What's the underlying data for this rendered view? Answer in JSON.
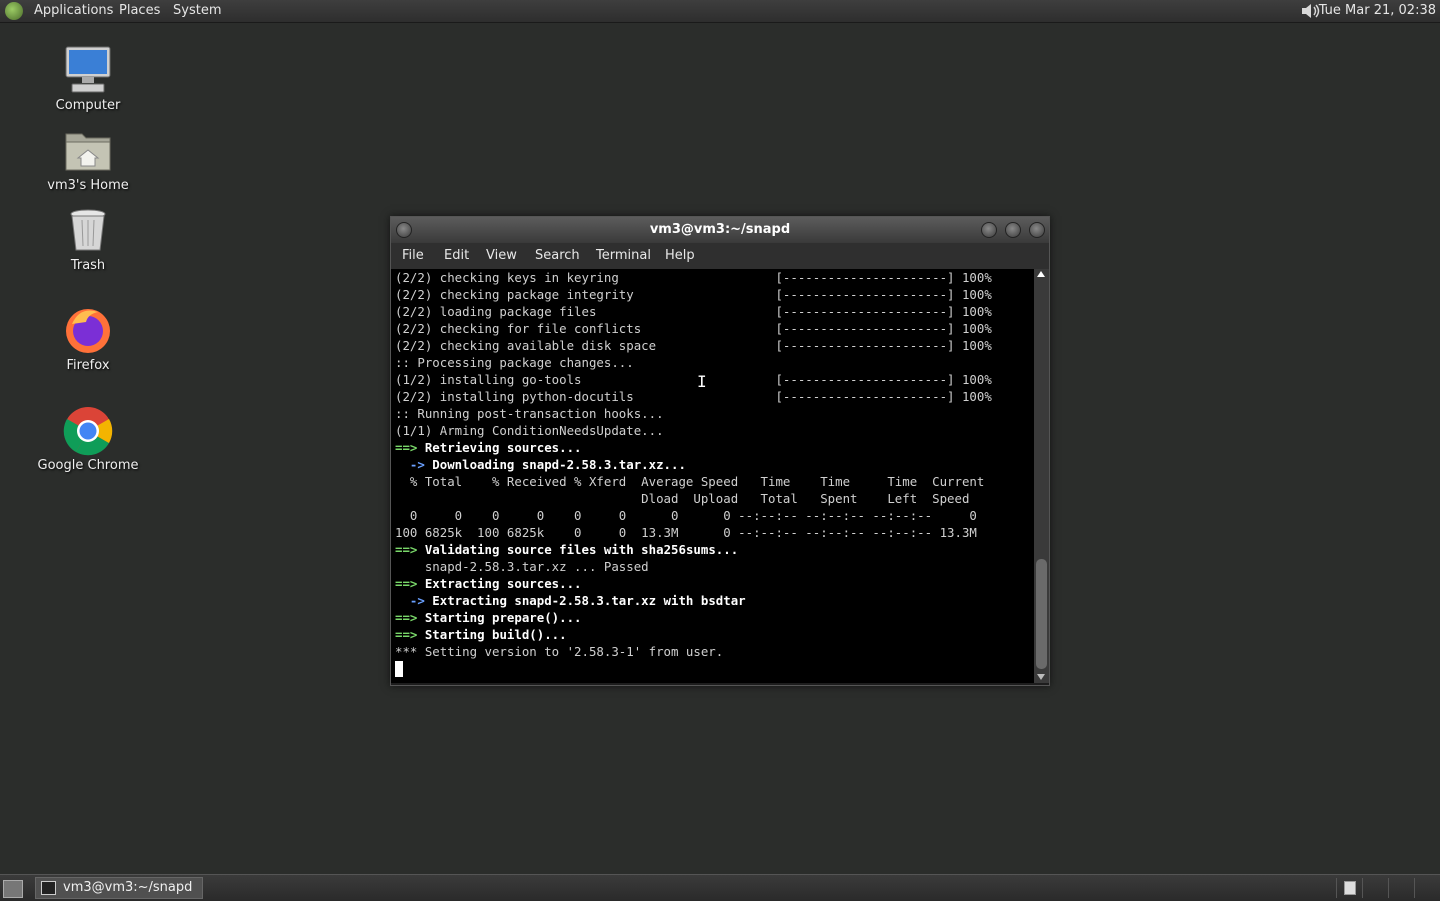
{
  "top_panel": {
    "menus": [
      "Applications",
      "Places",
      "System"
    ],
    "clock": "Tue Mar 21, 02:38"
  },
  "desktop_icons": [
    {
      "label": "Computer",
      "icon": "computer-icon"
    },
    {
      "label": "vm3's Home",
      "icon": "home-folder-icon"
    },
    {
      "label": "Trash",
      "icon": "trash-icon"
    },
    {
      "label": "Firefox",
      "icon": "firefox-icon"
    },
    {
      "label": "Google Chrome",
      "icon": "chrome-icon"
    }
  ],
  "terminal": {
    "title": "vm3@vm3:~/snapd",
    "menus": [
      "File",
      "Edit",
      "View",
      "Search",
      "Terminal",
      "Help"
    ],
    "lines": [
      {
        "prefix": "",
        "text": "(2/2) checking keys in keyring                     [----------------------] 100%",
        "style": "plain"
      },
      {
        "prefix": "",
        "text": "(2/2) checking package integrity                   [----------------------] 100%",
        "style": "plain"
      },
      {
        "prefix": "",
        "text": "(2/2) loading package files                        [----------------------] 100%",
        "style": "plain"
      },
      {
        "prefix": "",
        "text": "(2/2) checking for file conflicts                  [----------------------] 100%",
        "style": "plain"
      },
      {
        "prefix": "",
        "text": "(2/2) checking available disk space                [----------------------] 100%",
        "style": "plain"
      },
      {
        "prefix": "",
        "text": ":: Processing package changes...",
        "style": "plain"
      },
      {
        "prefix": "",
        "text": "(1/2) installing go-tools                          [----------------------] 100%",
        "style": "plain"
      },
      {
        "prefix": "",
        "text": "(2/2) installing python-docutils                   [----------------------] 100%",
        "style": "plain"
      },
      {
        "prefix": "",
        "text": ":: Running post-transaction hooks...",
        "style": "plain"
      },
      {
        "prefix": "",
        "text": "(1/1) Arming ConditionNeedsUpdate...",
        "style": "plain"
      },
      {
        "prefix": "==>",
        "text": " Retrieving sources...",
        "style": "green"
      },
      {
        "prefix": "  ->",
        "text": " Downloading snapd-2.58.3.tar.xz...",
        "style": "blue"
      },
      {
        "prefix": "",
        "text": "  % Total    % Received % Xferd  Average Speed   Time    Time     Time  Current",
        "style": "plain"
      },
      {
        "prefix": "",
        "text": "                                 Dload  Upload   Total   Spent    Left  Speed",
        "style": "plain"
      },
      {
        "prefix": "",
        "text": "  0     0    0     0    0     0      0      0 --:--:-- --:--:-- --:--:--     0",
        "style": "plain"
      },
      {
        "prefix": "",
        "text": "100 6825k  100 6825k    0     0  13.3M      0 --:--:-- --:--:-- --:--:-- 13.3M",
        "style": "plain"
      },
      {
        "prefix": "==>",
        "text": " Validating source files with sha256sums...",
        "style": "green"
      },
      {
        "prefix": "",
        "text": "    snapd-2.58.3.tar.xz ... Passed",
        "style": "plain"
      },
      {
        "prefix": "==>",
        "text": " Extracting sources...",
        "style": "green"
      },
      {
        "prefix": "  ->",
        "text": " Extracting snapd-2.58.3.tar.xz with bsdtar",
        "style": "blue"
      },
      {
        "prefix": "==>",
        "text": " Starting prepare()...",
        "style": "green"
      },
      {
        "prefix": "==>",
        "text": " Starting build()...",
        "style": "green"
      },
      {
        "prefix": "",
        "text": "*** Setting version to '2.58.3-1' from user.",
        "style": "plain"
      }
    ]
  },
  "bottom_panel": {
    "task_label": "vm3@vm3:~/snapd"
  }
}
